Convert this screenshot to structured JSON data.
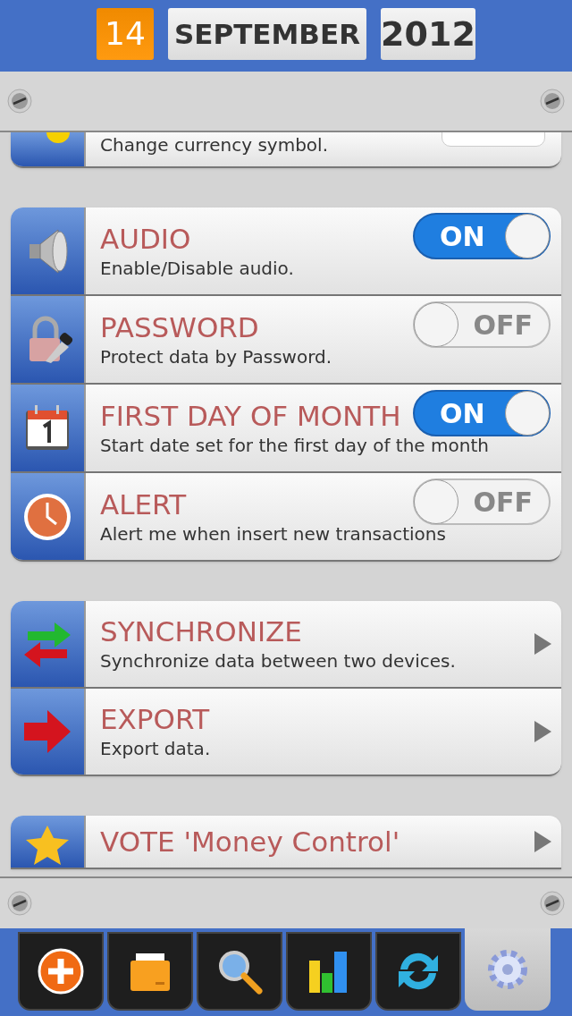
{
  "date": {
    "day": "14",
    "month": "SEPTEMBER",
    "year": "2012"
  },
  "sections": [
    {
      "rows": [
        {
          "kind": "field",
          "description": "Change currency symbol."
        }
      ]
    },
    {
      "rows": [
        {
          "kind": "toggle",
          "title": "AUDIO",
          "description": "Enable/Disable audio.",
          "on": true,
          "switch_label": "ON"
        },
        {
          "kind": "toggle",
          "title": "PASSWORD",
          "description": "Protect data by Password.",
          "on": false,
          "switch_label": "OFF"
        },
        {
          "kind": "toggle",
          "title": "FIRST DAY OF MONTH",
          "description": "Start date set for the first day of the month",
          "on": true,
          "switch_label": "ON"
        },
        {
          "kind": "toggle",
          "title": "ALERT",
          "description": "Alert me when insert new transactions",
          "on": false,
          "switch_label": "OFF"
        }
      ]
    },
    {
      "rows": [
        {
          "kind": "link",
          "title": "SYNCHRONIZE",
          "description": "Synchronize data between two devices."
        },
        {
          "kind": "link",
          "title": "EXPORT",
          "description": "Export data."
        }
      ]
    },
    {
      "rows": [
        {
          "kind": "link",
          "title": "VOTE 'Money Control'"
        }
      ]
    }
  ],
  "tabs": [
    {
      "selected": false
    },
    {
      "selected": false
    },
    {
      "selected": false
    },
    {
      "selected": false
    },
    {
      "selected": false
    },
    {
      "selected": true
    }
  ]
}
